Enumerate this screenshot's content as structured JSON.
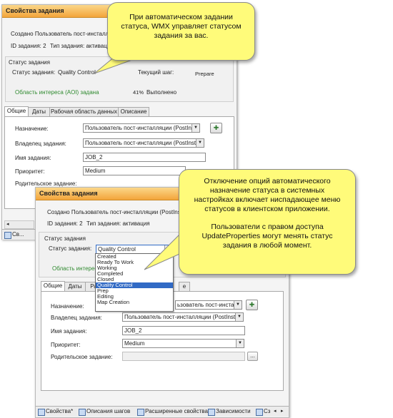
{
  "back_panel": {
    "title": "Свойства задания",
    "created_by": "Создано Пользователь пост-инсталляции (PostInst",
    "job_id": "ID задания: 2",
    "job_type": "Тип задания: активация",
    "status_group": "Статус задания",
    "status_label": "Статус задания:",
    "status_value": "Quality Control",
    "current_step_label": "Текущий шаг:",
    "current_step_value": "Prepare",
    "aoi_text": "Область интереса (AOI) задана",
    "percent": "41%",
    "done": "Выполнено",
    "tabs": [
      "Общие",
      "Даты",
      "Рабочая область данных",
      "Описание"
    ],
    "fields": {
      "assignment_label": "Назначение:",
      "assignment_value": "Пользователь пост-инсталляции (PostInst",
      "owner_label": "Владелец задания:",
      "owner_value": "Пользователь пост-инсталляции (PostInstall)",
      "name_label": "Имя задания:",
      "name_value": "JOB_2",
      "priority_label": "Приоритет:",
      "priority_value": "Medium",
      "parent_label": "Родительское задание:"
    },
    "bottom_tab": "Св..."
  },
  "front_panel": {
    "title": "Свойства задания",
    "created_by": "Создано Пользователь пост-инсталляции (PostInst",
    "job_id": "ID задания: 2",
    "job_type": "Тип задания: активация",
    "status_group": "Статус задания",
    "status_label": "Статус задания:",
    "status_value": "Quality Control",
    "aoi_text": "Область интерес",
    "status_options": [
      "Created",
      "Ready To Work",
      "Working",
      "Completed",
      "Closed",
      "Quality Control",
      "Prep",
      "Editing",
      "Map Creation"
    ],
    "selected_option": "Quality Control",
    "tabs": [
      "Общие",
      "Даты",
      "Ра"
    ],
    "tab_desc": "е",
    "fields": {
      "assignment_label": "Назначение:",
      "assignment_value": "ьзователь пост-инсталляции (PostInst",
      "owner_label": "Владелец задания:",
      "owner_value": "Пользователь пост-инсталляции (PostInstall)",
      "name_label": "Имя задания:",
      "name_value": "JOB_2",
      "priority_label": "Приоритет:",
      "priority_value": "Medium",
      "parent_label": "Родительское задание:",
      "browse": "..."
    },
    "bottom_tabs": [
      "Свойства*",
      "Описания шагов",
      "Расширенные свойства",
      "Зависимости",
      "Сз"
    ]
  },
  "callouts": {
    "top": "При автоматическом задании статуса, WMX управляет статусом задания за вас.",
    "bottom_p1": "Отключение опций автоматического назначение статуса в системных настройках включает ниспадающее меню статусов в клиентском приложении.",
    "bottom_p2": "Пользователи с правом доступа UpdateProperties могут менять статус задания в любой момент."
  },
  "colors": {
    "titlebar": "#f3a43b",
    "callout": "#fffb7a",
    "aoi_green": "#2f8a2f",
    "selection": "#316ac5"
  }
}
